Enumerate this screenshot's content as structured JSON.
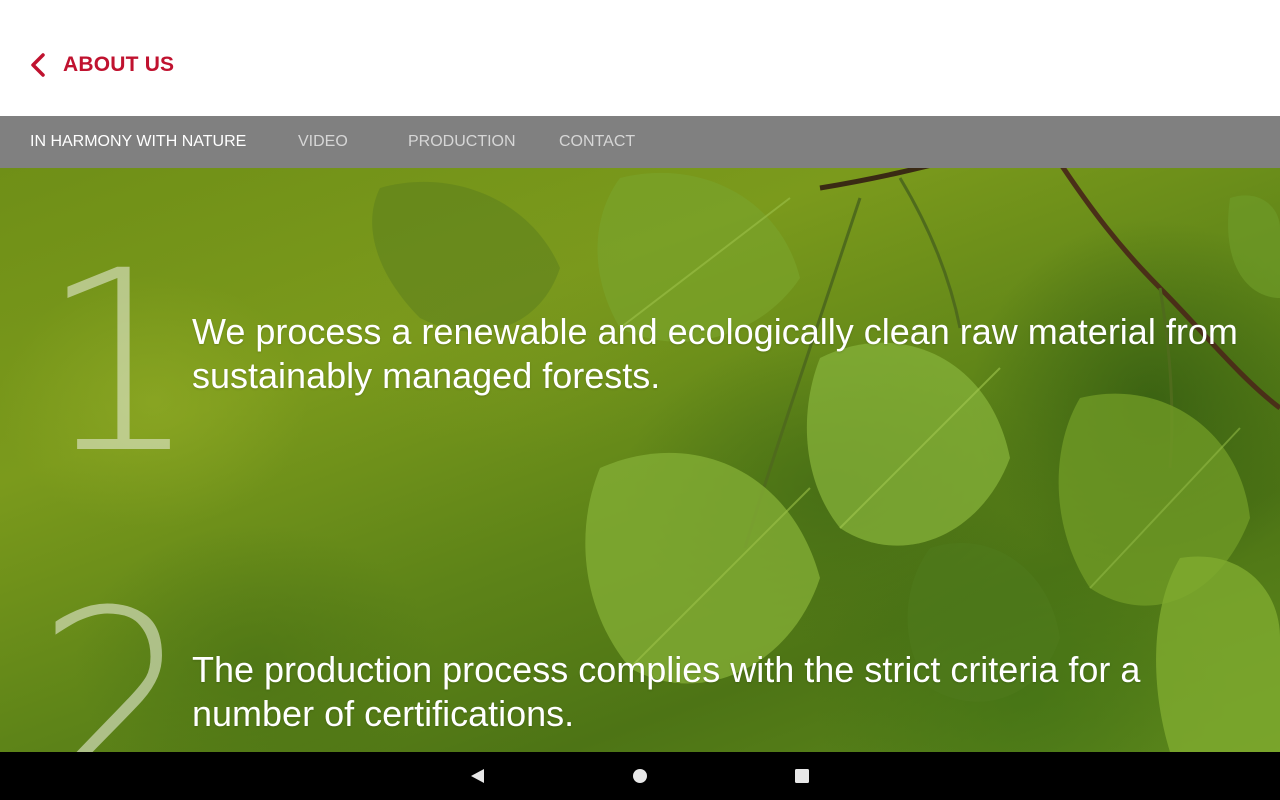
{
  "header": {
    "title": "ABOUT US",
    "back_icon": "chevron-left-icon",
    "accent_color": "#c0122f"
  },
  "tabs": [
    {
      "label": "IN HARMONY WITH NATURE",
      "active": true
    },
    {
      "label": "VIDEO",
      "active": false
    },
    {
      "label": "PRODUCTION",
      "active": false
    },
    {
      "label": "CONTACT",
      "active": false
    }
  ],
  "content": {
    "points": [
      {
        "number": "1",
        "text": "We process a renewable and ecologically clean raw material from sustainably managed forests."
      },
      {
        "number": "2",
        "text": "The production process complies with the strict criteria for a number of certifications."
      }
    ],
    "background_icon": "green-leaves-image"
  },
  "system_nav": {
    "back_icon": "triangle-back-icon",
    "home_icon": "circle-home-icon",
    "recents_icon": "square-recents-icon"
  }
}
